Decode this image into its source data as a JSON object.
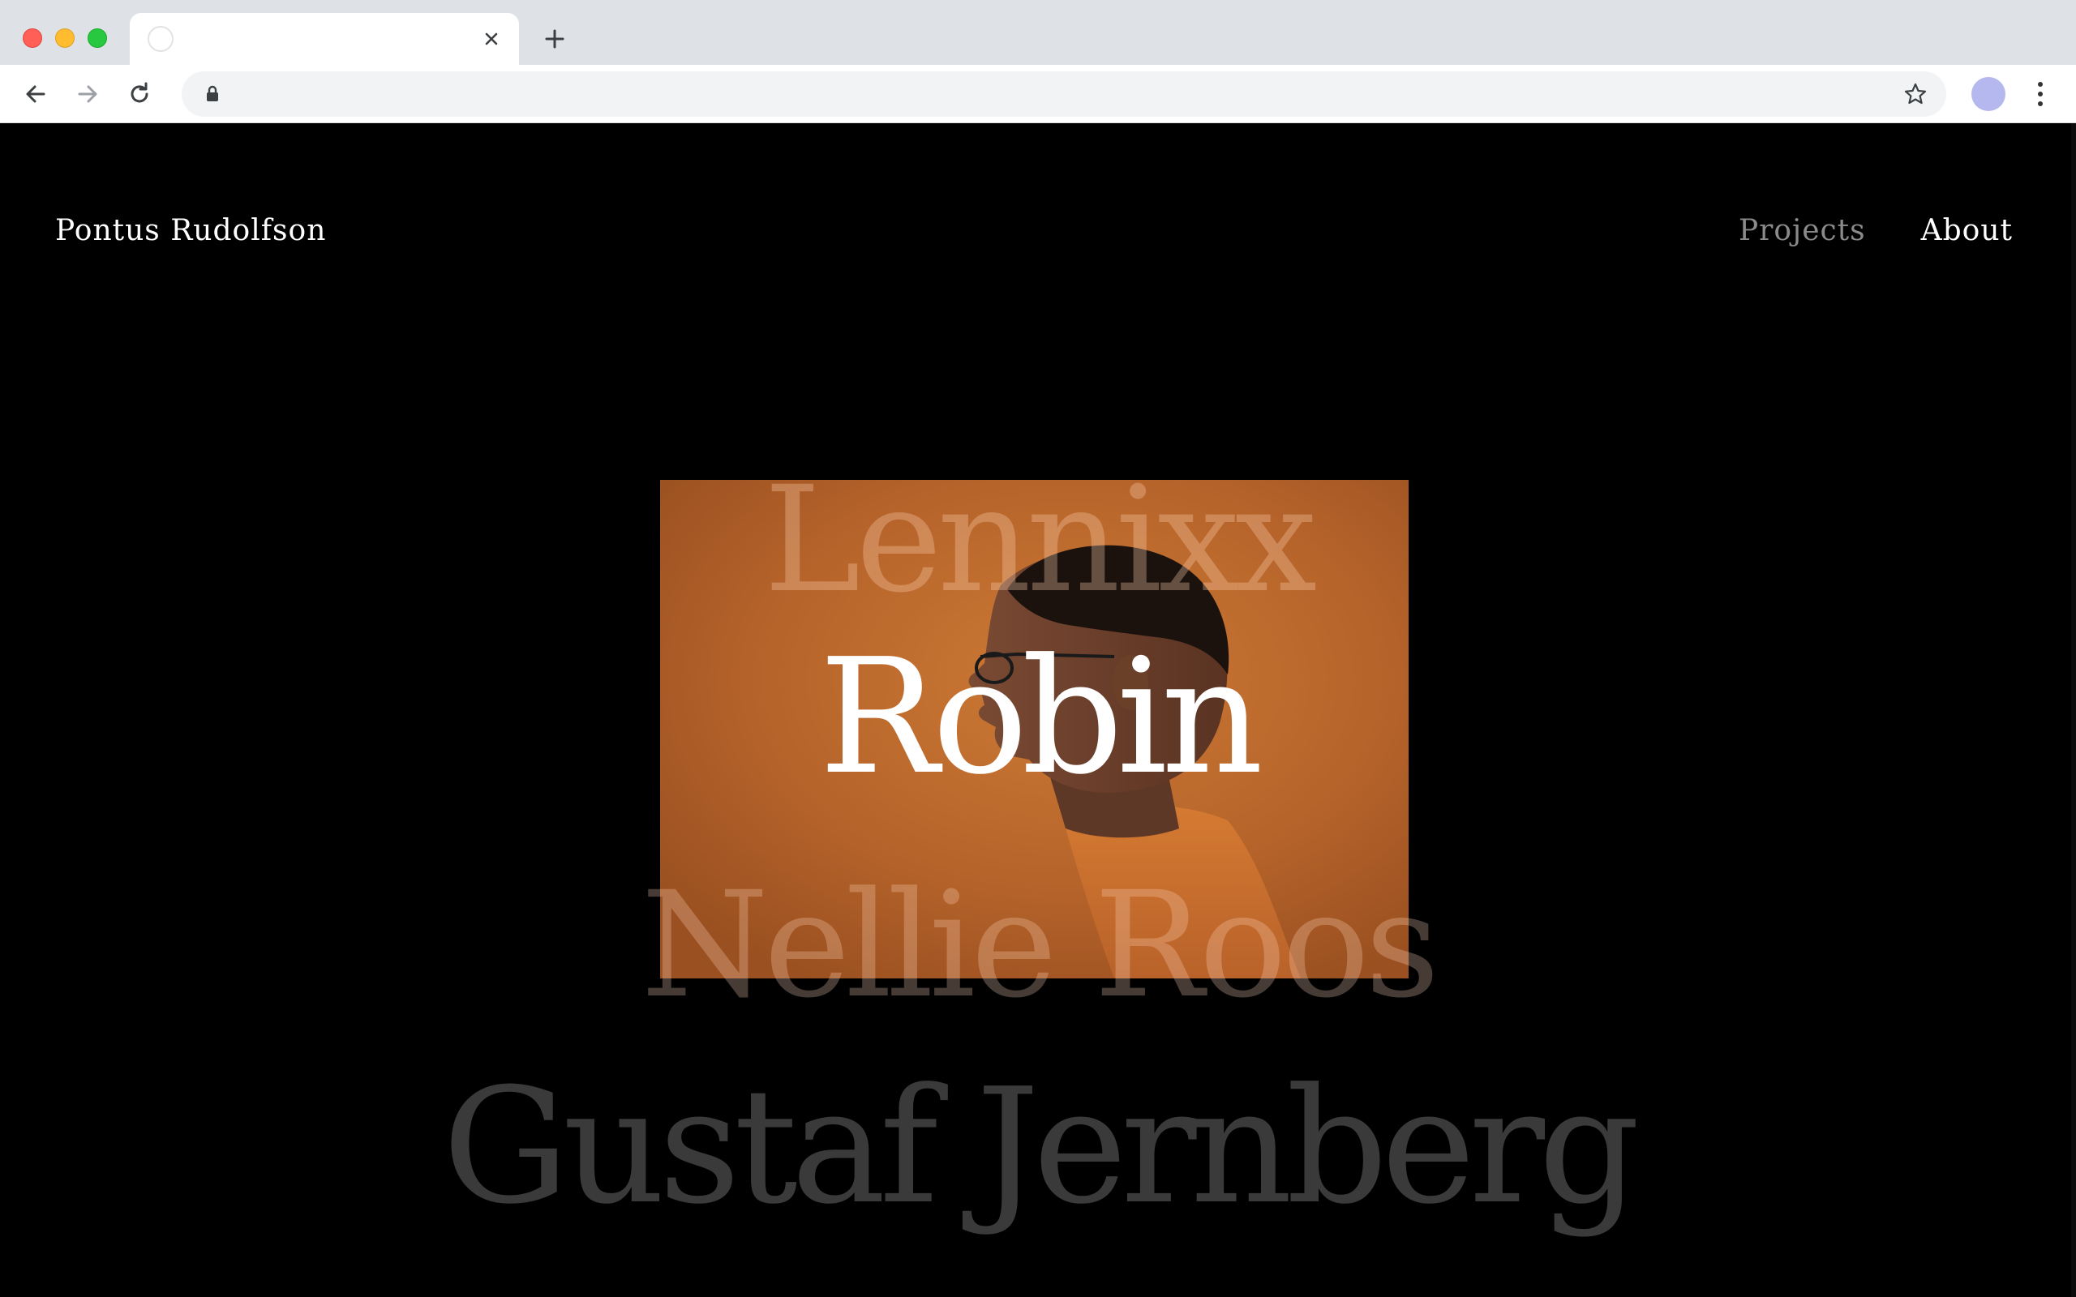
{
  "browser": {
    "tab": {
      "title": "",
      "favicon": "blank-favicon-icon",
      "close_icon": "close-icon"
    },
    "new_tab_icon": "plus-icon",
    "toolbar": {
      "back_icon": "arrow-left-icon",
      "forward_icon": "arrow-right-icon",
      "reload_icon": "reload-icon",
      "url": "",
      "lock_icon": "lock-icon",
      "bookmark_icon": "star-icon",
      "profile_color": "#b5b8ee",
      "menu_icon": "kebab-menu-icon"
    }
  },
  "site": {
    "logo": "Pontus Rudolfson",
    "nav": {
      "projects": "Projects",
      "about": "About"
    },
    "projects": [
      {
        "name": "Lennixx",
        "state": "faded"
      },
      {
        "name": "Robin",
        "state": "active"
      },
      {
        "name": "Nellie Roos",
        "state": "faded"
      },
      {
        "name": "Gustaf Jernberg",
        "state": "dim"
      }
    ],
    "hero_image": {
      "subject": "profile portrait of a man with glasses in an orange t-shirt on orange background",
      "background_color": "#b8652a"
    }
  },
  "colors": {
    "page_background": "#000000",
    "text_primary": "#ffffff",
    "nav_inactive": "#8a8a8a",
    "chrome_tabbar": "#dee1e6",
    "accent_orange": "#c8732f"
  }
}
